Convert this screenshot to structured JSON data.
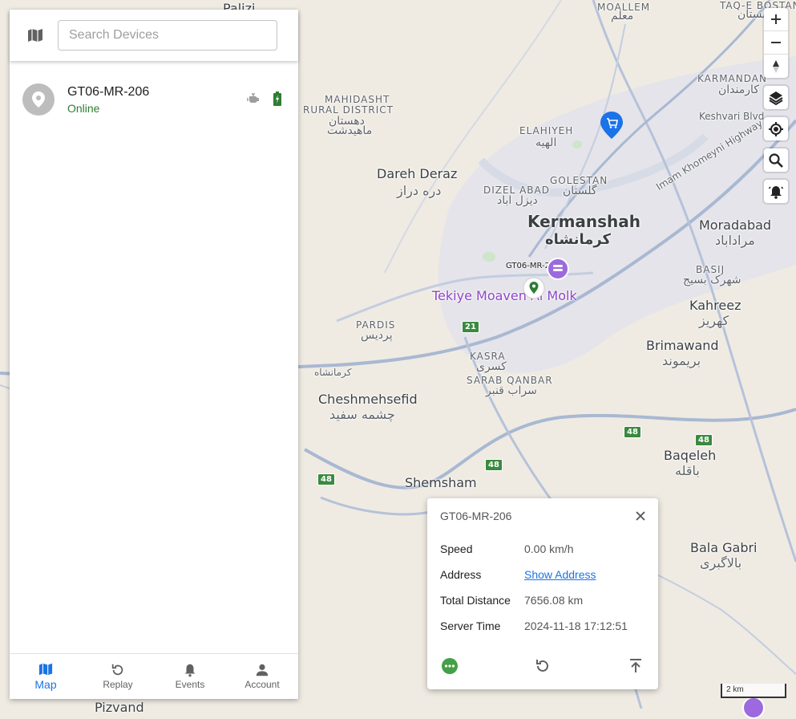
{
  "search": {
    "placeholder": "Search Devices"
  },
  "device": {
    "name": "GT06-MR-206",
    "status": "Online"
  },
  "nav": [
    {
      "label": "Map",
      "icon": "map-icon",
      "active": true
    },
    {
      "label": "Replay",
      "icon": "replay-icon"
    },
    {
      "label": "Events",
      "icon": "bell-icon"
    },
    {
      "label": "Account",
      "icon": "person-icon"
    }
  ],
  "map_controls": [
    "zoom-in-icon",
    "zoom-out-icon",
    "compass-icon",
    "layers-icon",
    "my-location-icon",
    "search-icon",
    "notifications-icon"
  ],
  "map_labels": {
    "kermanshah": "Kermanshah",
    "kermanshah_fa": "کرمانشاه",
    "poi": "Tekiye Moaven Al Molk",
    "dareh_deraz": "Dareh Deraz",
    "dareh_deraz_fa": "دره دراز",
    "moradabad": "Moradabad",
    "moradabad_fa": "مراداباد",
    "kahreez": "Kahreez",
    "kahreez_fa": "کهریز",
    "brimawand": "Brimawand",
    "brimawand_fa": "بریموند",
    "cheshmehsefid": "Cheshmehsefid",
    "cheshmehsefid_fa": "چشمه سفید",
    "baqeleh": "Baqeleh",
    "baqeleh_fa": "باقله",
    "shemsham": "Shemsham",
    "bala_gabri": "Bala Gabri",
    "bala_gabri_fa": "بالاگبری",
    "elahiyeh": "ELAHIYEH",
    "elahiyeh_fa": "الهیه",
    "golestan": "GOLESTAN",
    "golestan_fa": "گلستان",
    "dizel_abad": "DIZEL ABAD",
    "dizel_abad_fa": "دیزل اباد",
    "mahidasht_1": "MAHIDASHT",
    "mahidasht_2": "RURAL DISTRICT",
    "mahidasht_fa1": "دهستان",
    "mahidasht_fa2": "ماهیدشت",
    "pardis": "PARDIS",
    "pardis_fa": "پردیس",
    "kasra": "KASRA",
    "kasra_fa": "کسری",
    "sarab_qanbar": "SARAB QANBAR",
    "sarab_qanbar_fa": "سراب قنبر",
    "basij": "BASIJ",
    "basij_fa": "شهرک بسیج",
    "karmandan": "KARMANDAN",
    "karmandan_fa": "کارمندان",
    "keshvari_blvd": "Keshvari Blvd",
    "imam_khomeyni_hwy": "Imam Khomeyni Highway",
    "moallem": "MOALLEM",
    "moallem_fa": "معلم",
    "taq_e_bostan": "TAQ-E BOSTAN",
    "taq_e_bostan_fa": "بستان",
    "palizi": "Palizi",
    "kermanshah_road_fa": "کرمانشاه",
    "pizvand": "Pizvand",
    "marker_label": "GT06-MR-206"
  },
  "road_shields": [
    "21",
    "48",
    "48",
    "48",
    "48"
  ],
  "popup": {
    "title": "GT06-MR-206",
    "rows": [
      {
        "key": "Speed",
        "value": "0.00 km/h"
      },
      {
        "key": "Address",
        "value": "Show Address"
      },
      {
        "key": "Total Distance",
        "value": "7656.08 km"
      },
      {
        "key": "Server Time",
        "value": "2024-11-18 17:12:51"
      }
    ]
  },
  "scale": "2 km",
  "colors": {
    "accent": "#1a73e8",
    "online": "#2e7d32",
    "map_bg": "#efebe3",
    "road": "#a9b8d2",
    "marker_purple": "#9c6ade",
    "marker_green": "#2e7d32"
  }
}
